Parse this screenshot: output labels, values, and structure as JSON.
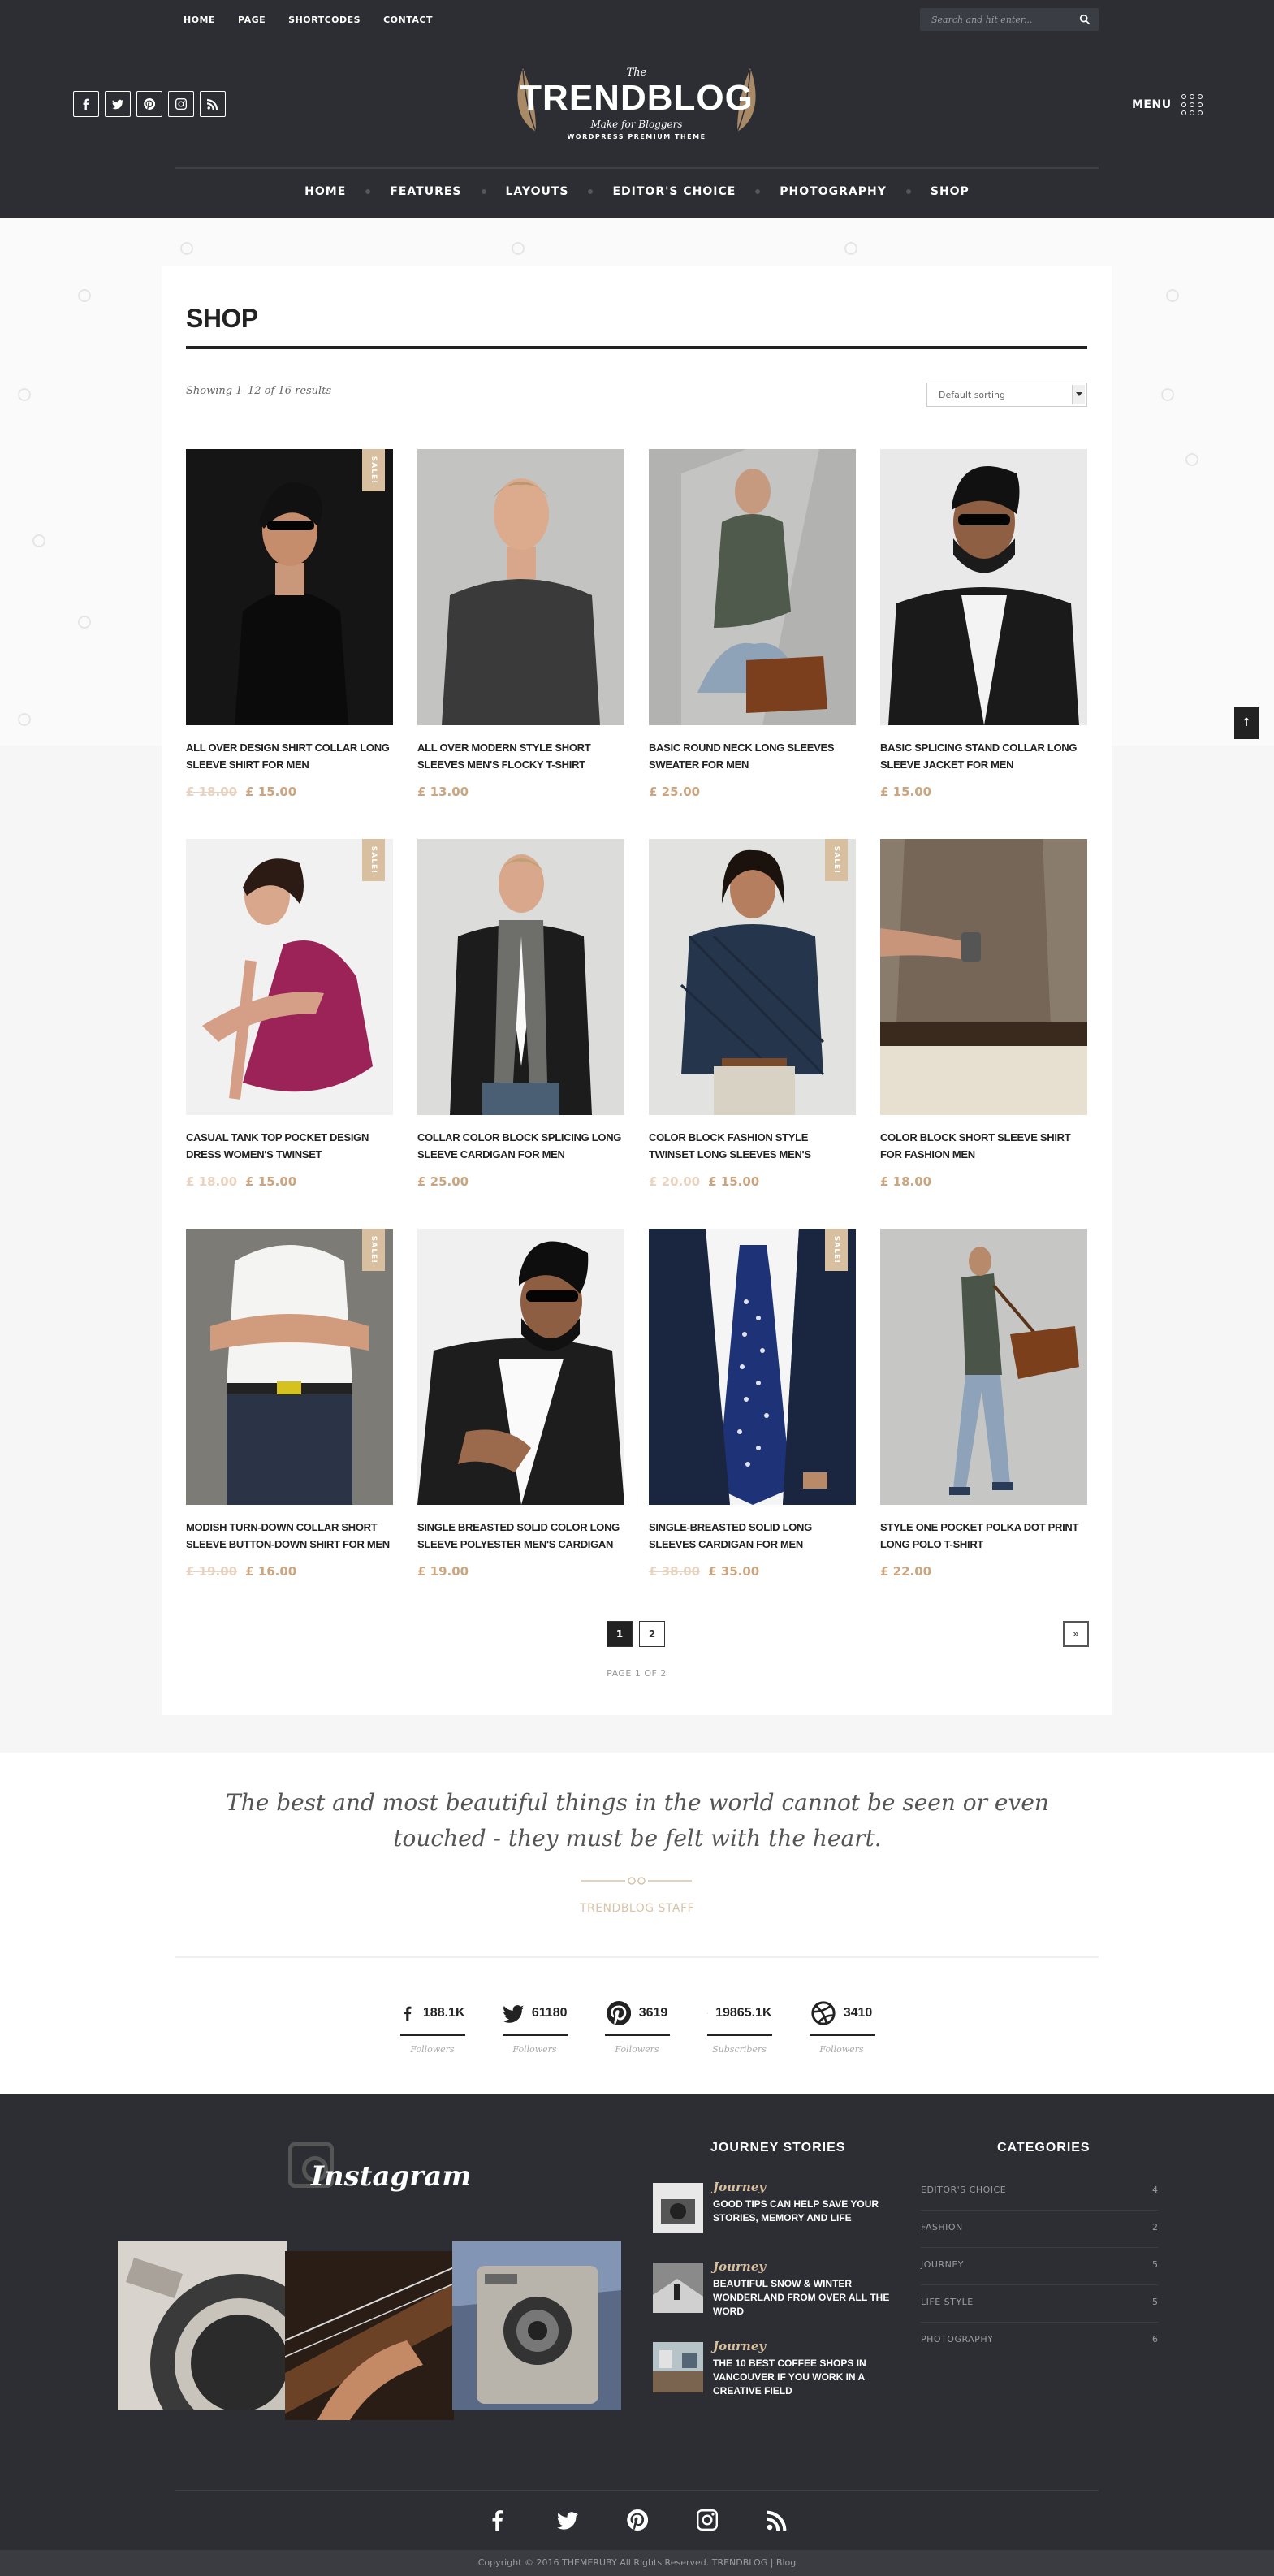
{
  "topbar": {
    "menu": [
      "HOME",
      "PAGE",
      "SHORTCODES",
      "CONTACT"
    ],
    "search_placeholder": "Search and hit enter..."
  },
  "header": {
    "social_icons": [
      "facebook-icon",
      "twitter-icon",
      "pinterest-icon",
      "instagram-icon",
      "rss-icon"
    ],
    "logo": {
      "prefix": "The",
      "name": "TRENDBLOG",
      "tagline": "Make for Bloggers",
      "subtitle": "WORDPRESS PREMIUM THEME"
    },
    "menu_label": "MENU"
  },
  "main_nav": [
    "HOME",
    "FEATURES",
    "LAYOUTS",
    "EDITOR'S CHOICE",
    "PHOTOGRAPHY",
    "SHOP"
  ],
  "shop": {
    "title": "SHOP",
    "result_count": "Showing 1–12 of 16 results",
    "sort_value": "Default sorting",
    "sale_label": "SALE!",
    "products": [
      {
        "name": "ALL OVER DESIGN SHIRT COLLAR LONG SLEEVE SHIRT FOR MEN",
        "old_price": "£ 18.00",
        "price": "£ 15.00",
        "sale": true
      },
      {
        "name": "ALL OVER MODERN STYLE SHORT SLEEVES MEN'S FLOCKY T-SHIRT",
        "old_price": "",
        "price": "£ 13.00",
        "sale": false
      },
      {
        "name": "BASIC ROUND NECK LONG SLEEVES SWEATER FOR MEN",
        "old_price": "",
        "price": "£ 25.00",
        "sale": false
      },
      {
        "name": "BASIC SPLICING STAND COLLAR LONG SLEEVE JACKET FOR MEN",
        "old_price": "",
        "price": "£ 15.00",
        "sale": false
      },
      {
        "name": "CASUAL TANK TOP POCKET DESIGN DRESS WOMEN'S TWINSET",
        "old_price": "£ 18.00",
        "price": "£ 15.00",
        "sale": true
      },
      {
        "name": "COLLAR COLOR BLOCK SPLICING LONG SLEEVE CARDIGAN FOR MEN",
        "old_price": "",
        "price": "£ 25.00",
        "sale": false
      },
      {
        "name": "COLOR BLOCK FASHION STYLE TWINSET LONG SLEEVES MEN'S",
        "old_price": "£ 20.00",
        "price": "£ 15.00",
        "sale": true
      },
      {
        "name": "COLOR BLOCK SHORT SLEEVE SHIRT FOR FASHION MEN",
        "old_price": "",
        "price": "£ 18.00",
        "sale": false
      },
      {
        "name": "MODISH TURN-DOWN COLLAR SHORT SLEEVE BUTTON-DOWN SHIRT FOR MEN",
        "old_price": "£ 19.00",
        "price": "£ 16.00",
        "sale": true
      },
      {
        "name": "SINGLE BREASTED SOLID COLOR LONG SLEEVE POLYESTER MEN'S CARDIGAN",
        "old_price": "",
        "price": "£ 19.00",
        "sale": false
      },
      {
        "name": "SINGLE-BREASTED SOLID LONG SLEEVES CARDIGAN FOR MEN",
        "old_price": "£ 38.00",
        "price": "£ 35.00",
        "sale": true
      },
      {
        "name": "STYLE ONE POCKET POLKA DOT PRINT LONG POLO T-SHIRT",
        "old_price": "",
        "price": "£ 22.00",
        "sale": false
      }
    ],
    "pagination": {
      "pages": [
        "1",
        "2"
      ],
      "next": "»",
      "page_of": "PAGE 1 OF 2"
    }
  },
  "back_to_top": "↑",
  "quote": {
    "text": "The best and most beautiful things in the world cannot be seen or even touched - they must be felt with the heart.",
    "author": "TRENDBLOG STAFF"
  },
  "counters": [
    {
      "icon": "facebook-icon",
      "value": "188.1K",
      "label": "Followers"
    },
    {
      "icon": "twitter-icon",
      "value": "61180",
      "label": "Followers"
    },
    {
      "icon": "pinterest-icon",
      "value": "3619",
      "label": "Followers"
    },
    {
      "icon": "youtube-icon",
      "value": "19865.1K",
      "label": "Subscribers"
    },
    {
      "icon": "dribbble-icon",
      "value": "3410",
      "label": "Followers"
    }
  ],
  "footer": {
    "instagram_title": "Instagram",
    "journey_title": "JOURNEY STORIES",
    "stories": [
      {
        "category": "Journey",
        "title": "GOOD TIPS CAN HELP SAVE YOUR STORIES, MEMORY AND LIFE"
      },
      {
        "category": "Journey",
        "title": "BEAUTIFUL SNOW & WINTER WONDERLAND FROM OVER ALL THE WORD"
      },
      {
        "category": "Journey",
        "title": "THE 10 BEST COFFEE SHOPS IN VANCOUVER IF YOU WORK IN A CREATIVE FIELD"
      }
    ],
    "categories_title": "CATEGORIES",
    "categories": [
      {
        "name": "EDITOR'S CHOICE",
        "count": "4"
      },
      {
        "name": "FASHION",
        "count": "2"
      },
      {
        "name": "JOURNEY",
        "count": "5"
      },
      {
        "name": "LIFE STYLE",
        "count": "5"
      },
      {
        "name": "PHOTOGRAPHY",
        "count": "6"
      }
    ],
    "social_icons": [
      "facebook-icon",
      "twitter-icon",
      "pinterest-icon",
      "instagram-icon",
      "rss-icon"
    ],
    "copyright": "Copyright © 2016 THEMERUBY All Rights Reserved. TRENDBLOG | Blog"
  },
  "colors": {
    "dark": "#2c2e33",
    "accent": "#cba57f",
    "sale": "#d7bf9f"
  }
}
